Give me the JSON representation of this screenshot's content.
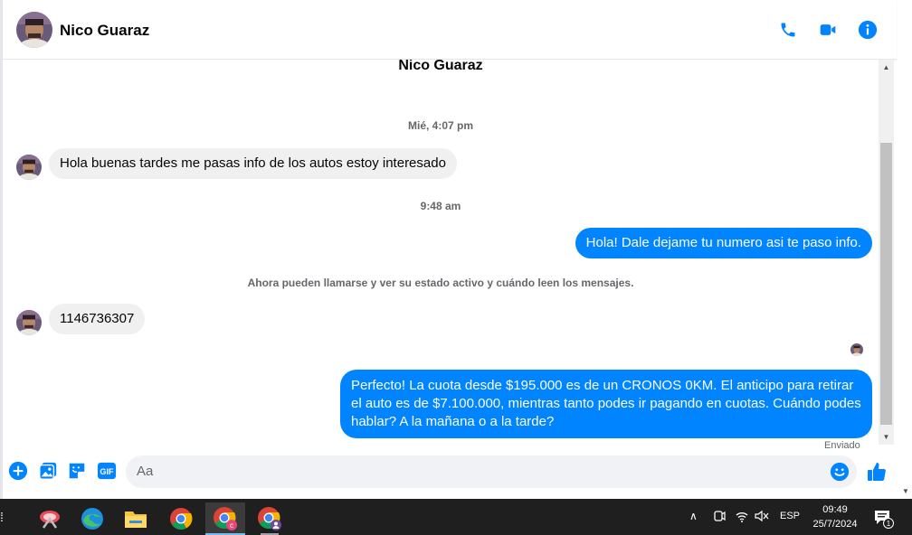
{
  "header": {
    "contact_name": "Nico Guaraz",
    "icons": [
      "phone-icon",
      "video-camera-icon",
      "info-icon"
    ]
  },
  "thread": {
    "title": "Nico Guaraz",
    "timestamp_1": "Mié, 4:07 pm",
    "msg_1": "Hola buenas tardes me pasas info de los autos estoy interesado",
    "timestamp_2": "9:48 am",
    "msg_2": "Hola! Dale dejame tu numero  asi te paso info.",
    "notice": "Ahora pueden llamarse y ver su estado activo y cuándo leen los mensajes.",
    "msg_3": "1146736307",
    "msg_4": "Perfecto! La cuota desde $195.000 es de un CRONOS 0KM. El anticipo para retirar el auto es de $7.100.000, mientras tanto podes ir pagando en cuotas. Cuándo podes hablar? A la mañana o a la tarde?",
    "status": "Enviado"
  },
  "composer": {
    "placeholder": "Aa",
    "icons": [
      "plus-icon",
      "image-icon",
      "sticker-icon",
      "gif-icon",
      "emoji-icon",
      "like-icon"
    ],
    "gif_label": "GIF"
  },
  "taskbar": {
    "apps": [
      "snipping-tool",
      "edge",
      "file-explorer",
      "chrome",
      "chrome-profile-c",
      "chrome-profile-2"
    ],
    "tray": {
      "language": "ESP",
      "time": "09:49",
      "date": "25/7/2024",
      "notification_count": "1"
    }
  },
  "colors": {
    "accent": "#0084ff",
    "incoming_bubble": "#f0f0f0",
    "taskbar": "#1f1f1f"
  }
}
